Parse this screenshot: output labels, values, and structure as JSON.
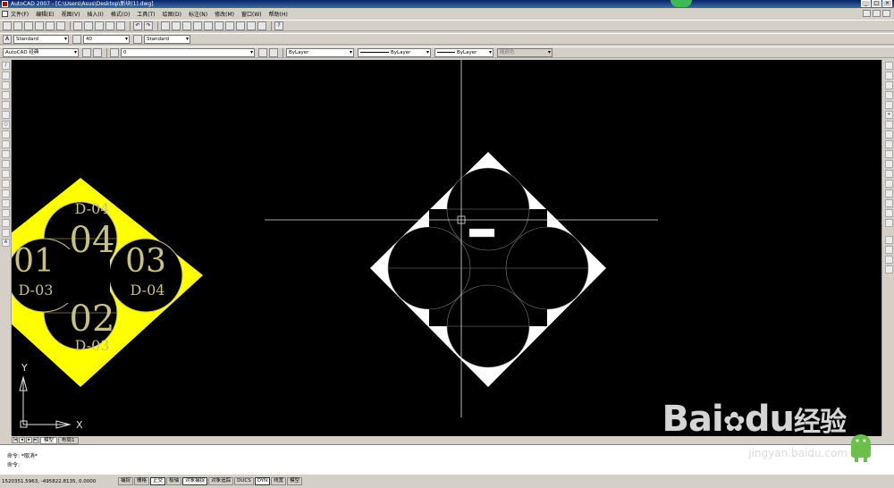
{
  "window": {
    "title": "AutoCAD 2007 - [C:\\Users\\Asus\\Desktop\\新块(1).dwg]"
  },
  "menu": [
    "文件(F)",
    "编辑(E)",
    "视图(V)",
    "插入(I)",
    "格式(O)",
    "工具(T)",
    "绘图(D)",
    "标注(N)",
    "修改(M)",
    "窗口(W)",
    "帮助(H)"
  ],
  "styles": {
    "text_style": "Standard",
    "text_height": "40",
    "dim_style": "Standard"
  },
  "workspace": {
    "name": "AutoCAD 经典",
    "layer": "0"
  },
  "properties": {
    "color": "ByLayer",
    "linetype": "ByLayer",
    "lineweight": "ByLayer",
    "plotstyle": "随颜色"
  },
  "drawing": {
    "left_block": {
      "labels": [
        "D-04",
        "04",
        "01",
        "03",
        "D-03",
        "D-04",
        "02",
        "D-03"
      ]
    },
    "cursor_tooltip": ""
  },
  "ucs": {
    "x_label": "X",
    "y_label": "Y"
  },
  "tabs": {
    "model": "模型",
    "layout1": "布局1"
  },
  "command": {
    "line1": "命令: *取消*",
    "line2": "命令:"
  },
  "status": {
    "coords": "1520351.5963, -495822.8135, 0.0000",
    "buttons": [
      "捕捉",
      "栅格",
      "正交",
      "极轴",
      "对象捕捉",
      "对象追踪",
      "DUCS",
      "DYN",
      "线宽",
      "模型"
    ]
  },
  "watermark": {
    "main": "Bai",
    "paw": "du",
    "cn": "经验",
    "url": "jingyan.baidu.com"
  },
  "colors": {
    "canvas": "#000000",
    "block_fill": "#ffff00",
    "block_text": "#c8c080",
    "white": "#ffffff"
  }
}
